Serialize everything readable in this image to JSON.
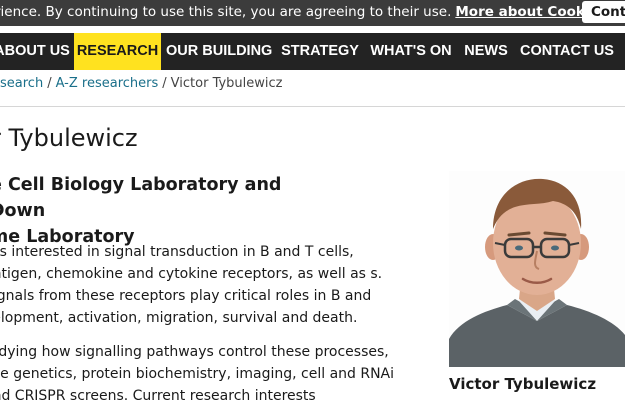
{
  "cookie_bar": {
    "text": "rience. By continuing to use this site, you are agreeing to their use.",
    "link": "More about Cookies",
    "button": "Conti"
  },
  "nav": {
    "items": [
      {
        "label": "ABOUT US"
      },
      {
        "label": "RESEARCH",
        "active": true
      },
      {
        "label": "OUR BUILDING"
      },
      {
        "label": "STRATEGY"
      },
      {
        "label": "WHAT'S ON"
      },
      {
        "label": "NEWS"
      },
      {
        "label": "CONTACT US"
      }
    ]
  },
  "breadcrumb": {
    "items": [
      "esearch",
      "A-Z researchers"
    ],
    "current": "Victor Tybulewicz"
  },
  "page_title": "r Tybulewicz",
  "lab_title": "e Cell Biology Laboratory and Down\nme Laboratory",
  "bio": {
    "p1": "s is interested in signal transduction in B and T cells, antigen, chemokine and cytokine receptors, as well as s. Signals from these receptors play critical roles in B and velopment, activation, migration, survival and death.",
    "p2": "tudying how signalling pathways control these processes, use genetics, protein biochemistry, imaging, cell and RNAi and CRISPR screens. Current research interests"
  },
  "photo": {
    "caption": "Victor Tybulewicz"
  },
  "colors": {
    "nav_bg": "#232323",
    "active": "#ffe21f",
    "cookie_bg": "#3c3c3c",
    "link": "#1a6f8a"
  }
}
